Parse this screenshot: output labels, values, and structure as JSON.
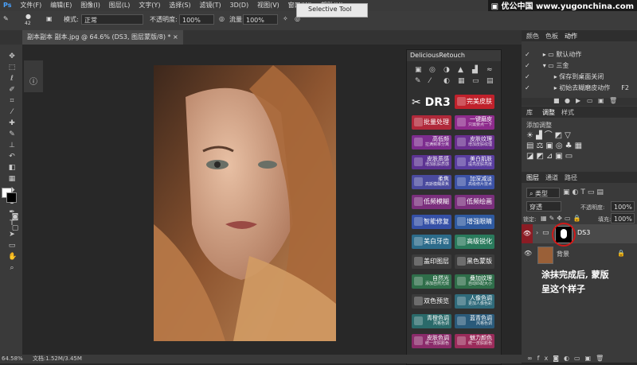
{
  "menu": [
    "文件(F)",
    "编辑(E)",
    "图像(I)",
    "图层(L)",
    "文字(Y)",
    "选择(S)",
    "滤镜(T)",
    "3D(D)",
    "视图(V)",
    "窗口(W)",
    "帮助(H)"
  ],
  "watermark": "▣ 优公中国  www.yugonchina.com",
  "options": {
    "brush_size": "42",
    "mode_label": "模式:",
    "mode_value": "正常",
    "opacity_label": "不透明度:",
    "opacity_value": "100%",
    "flow_label": "流量:",
    "flow_value": "100%"
  },
  "document_tab": "副本副本 副本.jpg @ 64.6% (DS3, 图层蒙版/8) *",
  "selective_tool": "Selective Tool",
  "retouch_panel": {
    "title": "DeliciousRetouch",
    "dr3": "DR3",
    "buttons": [
      {
        "label": "完美皮肤",
        "sub": "",
        "color": "#c0212b"
      },
      {
        "label": "批量处理",
        "sub": "",
        "color": "#b0293a"
      },
      {
        "label": "一键磨皮",
        "sub": "只需要点一下",
        "color": "#8e2b8c"
      },
      {
        "label": "高低频",
        "sub": "拉满频率分离",
        "color": "#7c2c8e"
      },
      {
        "label": "皮肤纹理",
        "sub": "增加皮肤纹理",
        "color": "#6a2f8f"
      },
      {
        "label": "皮肤质感",
        "sub": "增加肌肤质感",
        "color": "#5c3392"
      },
      {
        "label": "美白肌肤",
        "sub": "提亮皮肤亮度",
        "color": "#5a3ea0"
      },
      {
        "label": "柔焦",
        "sub": "高斯模糊柔焦",
        "color": "#4a4a9e"
      },
      {
        "label": "加深减淡",
        "sub": "高级修片技术",
        "color": "#3c52a6"
      },
      {
        "label": "低频模糊",
        "sub": "",
        "color": "#7a2f7c"
      },
      {
        "label": "低频绘画",
        "sub": "",
        "color": "#7a2f7c"
      },
      {
        "label": "智能修复",
        "sub": "",
        "color": "#3550a6"
      },
      {
        "label": "增强眼睛",
        "sub": "",
        "color": "#2f5aa0"
      },
      {
        "label": "美白牙齿",
        "sub": "",
        "color": "#2c6b8a"
      },
      {
        "label": "高级锐化",
        "sub": "",
        "color": "#2a7a5c"
      },
      {
        "label": "盖印图层",
        "sub": "",
        "color": "#3c3c3c"
      },
      {
        "label": "黑色蒙版",
        "sub": "",
        "color": "#3c3c3c"
      },
      {
        "label": "自然光",
        "sub": "添加自然光效",
        "color": "#2f6e4a"
      },
      {
        "label": "叠加纹理",
        "sub": "自动匹配大小",
        "color": "#2f6e4a"
      },
      {
        "label": "双色预览",
        "sub": "",
        "color": "#3c3c3c"
      },
      {
        "label": "人像色调",
        "sub": "更加人像色彩",
        "color": "#2f6a7a"
      },
      {
        "label": "青橙色调",
        "sub": "风格色调",
        "color": "#2a6a6a"
      },
      {
        "label": "蓝青色调",
        "sub": "风格色调",
        "color": "#2a5a7a"
      },
      {
        "label": "皮肤色调",
        "sub": "统一皮肤颜色",
        "color": "#8a2b6a"
      },
      {
        "label": "魅力颜色",
        "sub": "统一皮肤颜色",
        "color": "#9a2b5a"
      }
    ]
  },
  "actions_panel": {
    "tabs": [
      "颜色",
      "色板",
      "动作"
    ],
    "items": [
      "默认动作",
      "三金",
      "保存到桌面关闭",
      "初始去糊磨皮动作"
    ],
    "shortcut": "F2"
  },
  "adjust_panel": {
    "tabs": [
      "库",
      "调整",
      "样式"
    ],
    "add_label": "添加调整"
  },
  "layers_panel": {
    "tabs": [
      "图层",
      "通道",
      "路径"
    ],
    "kind": "类型",
    "blend": "穿透",
    "opacity_label": "不透明度:",
    "opacity": "100%",
    "lock_label": "锁定:",
    "fill_label": "填充:",
    "fill": "100%",
    "group_name": "DS3",
    "bg_name": "背景"
  },
  "annotation": [
    "涂抹完成后, 蒙版",
    "呈这个样子"
  ],
  "status": {
    "zoom": "64.58%",
    "doc": "文档:1.52M/3.45M"
  }
}
